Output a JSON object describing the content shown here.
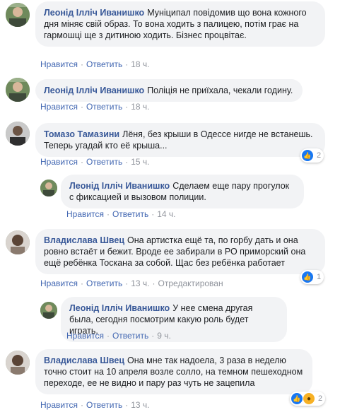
{
  "comments": [
    {
      "author": "Леонід Ілліч Иванишко",
      "text": "Муніципал повідомив що вона кожного дня міняє свій образ. То вона ходить з палицею, потім грає на гармошці ще з дитиною ходить. Бізнес процвітає.",
      "like": "Нравится",
      "reply": "Ответить",
      "time": "18 ч."
    },
    {
      "author": "Леонід Ілліч Иванишко",
      "text": "Поліція не приїхала, чекали годину.",
      "like": "Нравится",
      "reply": "Ответить",
      "time": "18 ч."
    },
    {
      "author": "Томазо Тамазини",
      "text": "Лёня, без крыши в Одессе нигде не встанешь. Теперь угадай кто её крыша...",
      "like": "Нравится",
      "reply": "Ответить",
      "time": "15 ч.",
      "reaction_count": "2"
    },
    {
      "author": "Леонід Ілліч Иванишко",
      "text": "Сделаем еще пару прогулок с фиксацией и вызовом полиции.",
      "like": "Нравится",
      "reply": "Ответить",
      "time": "14 ч."
    },
    {
      "author": "Владислава Швец",
      "text": "Она артистка ещё та, по горбу дать и она ровно встаёт и бежит. Вроде ее забирали в РО приморский она ещё ребёнка Тоскана за собой. Щас без ребёнка работает",
      "like": "Нравится",
      "reply": "Ответить",
      "time": "13 ч.",
      "edited": "Отредактирован",
      "reaction_count": "1"
    },
    {
      "author": "Леонід Ілліч Иванишко",
      "text": "У нее смена другая была, сегодня посмотрим какую роль будет играть.",
      "like": "Нравится",
      "reply": "Ответить",
      "time": "9 ч."
    },
    {
      "author": "Владислава Швец",
      "text": "Она мне так надоела, 3 раза в неделю точно стоит на 10 апреля возле солло, на темном пешеходном переходе, ее не видно и пару раз чуть не зацепила",
      "like": "Нравится",
      "reply": "Ответить",
      "time": "13 ч.",
      "reaction_count": "2"
    }
  ],
  "separator": "·",
  "colors": {
    "author": "#385898",
    "link": "#4267b2",
    "meta": "#90949c",
    "bubble": "#f2f3f5",
    "like": "#1877f2",
    "wow": "#f7b125"
  }
}
